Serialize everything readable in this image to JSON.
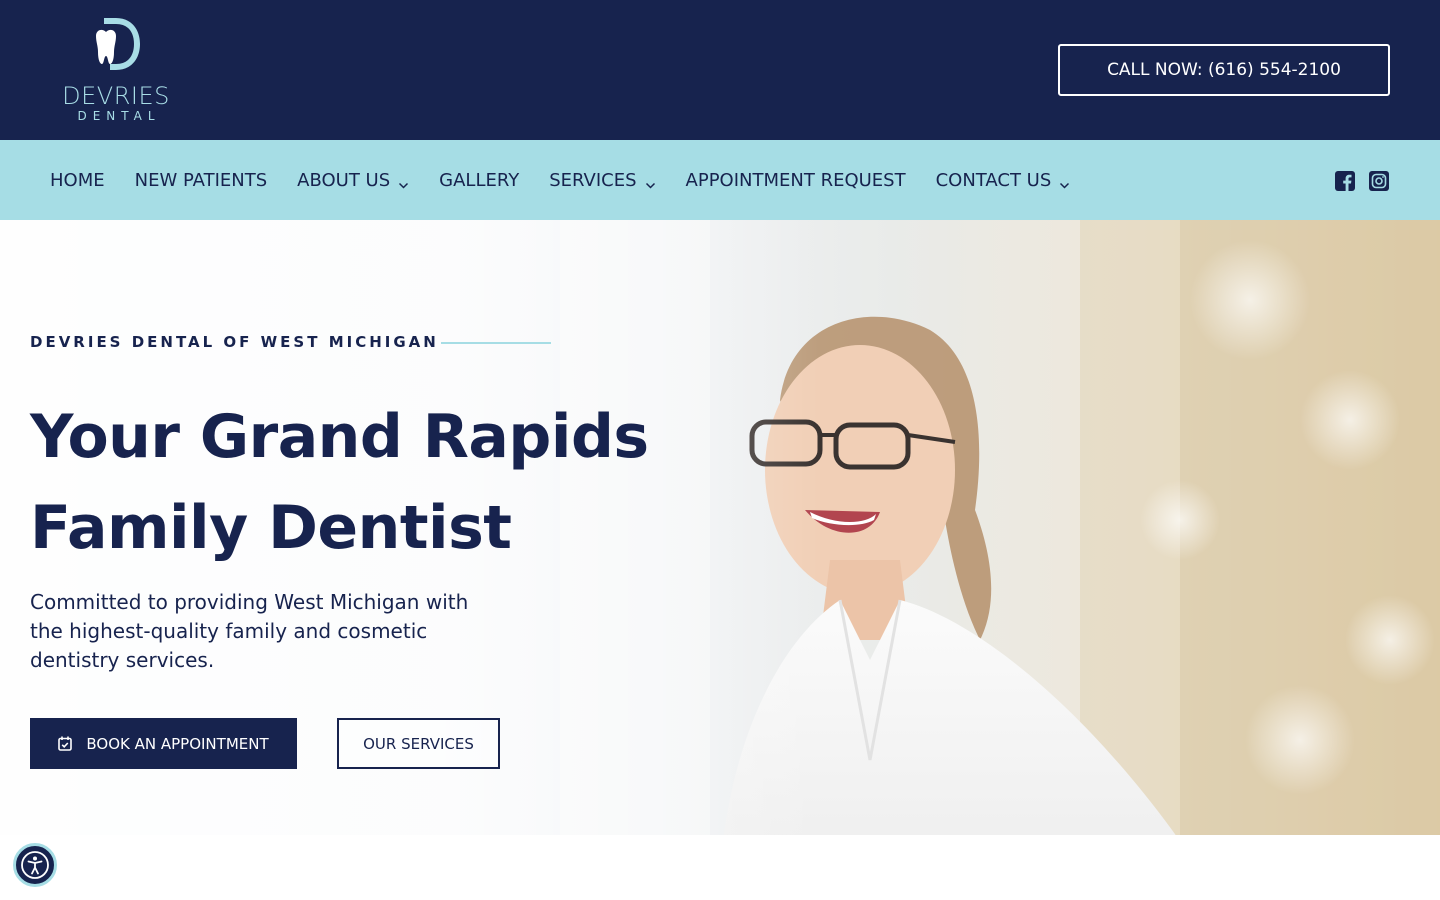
{
  "header": {
    "logo_word": "DEVRIES",
    "logo_sub": "DENTAL",
    "call_label": "CALL NOW: (616) 554-2100"
  },
  "nav": {
    "items": [
      {
        "label": "HOME",
        "has_dropdown": false
      },
      {
        "label": "NEW PATIENTS",
        "has_dropdown": false
      },
      {
        "label": "ABOUT US",
        "has_dropdown": true
      },
      {
        "label": "GALLERY",
        "has_dropdown": false
      },
      {
        "label": "SERVICES",
        "has_dropdown": true
      },
      {
        "label": "APPOINTMENT REQUEST",
        "has_dropdown": false
      },
      {
        "label": "CONTACT US",
        "has_dropdown": true
      }
    ],
    "social": [
      "facebook-icon",
      "instagram-icon"
    ]
  },
  "hero": {
    "eyebrow": "DEVRIES DENTAL OF WEST MICHIGAN",
    "headline_line1": "Your Grand Rapids",
    "headline_line2": "Family Dentist",
    "subcopy": "Committed to providing West Michigan with the highest-quality family and cosmetic dentistry services.",
    "book_label": "BOOK AN APPOINTMENT",
    "services_label": "OUR SERVICES"
  },
  "colors": {
    "navy": "#17234e",
    "light_blue": "#a6dde5",
    "white": "#ffffff"
  }
}
